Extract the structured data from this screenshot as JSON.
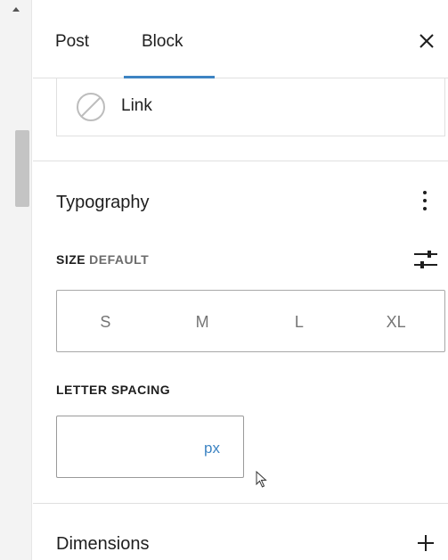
{
  "tabs": {
    "post": "Post",
    "block": "Block"
  },
  "link_block": {
    "label": "Link"
  },
  "typography": {
    "title": "Typography",
    "size_label": "SIZE",
    "size_value": "DEFAULT",
    "size_options": [
      "S",
      "M",
      "L",
      "XL"
    ],
    "letter_spacing_label": "LETTER SPACING",
    "letter_spacing_value": "",
    "letter_spacing_unit": "px"
  },
  "dimensions": {
    "title": "Dimensions"
  },
  "colors": {
    "accent": "#3d84c3",
    "text": "#1e1e1e",
    "muted": "#757575",
    "border": "#e0e0e0"
  },
  "icons": {
    "close": "close-icon",
    "block": "no-entry-icon",
    "more": "vertical-ellipsis-icon",
    "size_custom": "sliders-icon",
    "add": "plus-icon"
  }
}
